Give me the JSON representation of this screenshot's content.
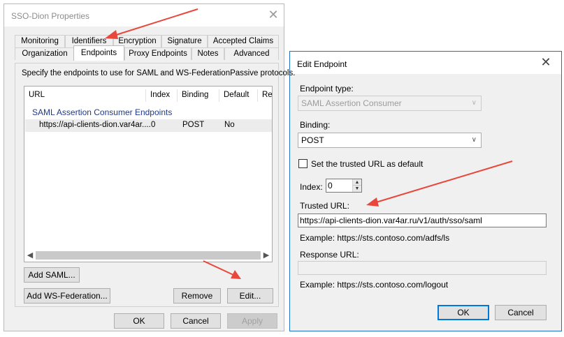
{
  "properties_dialog": {
    "title": "SSO-Dion Properties",
    "close_glyph": "✕",
    "tabs_row1": [
      "Monitoring",
      "Identifiers",
      "Encryption",
      "Signature",
      "Accepted Claims"
    ],
    "tabs_row2": [
      "Organization",
      "Endpoints",
      "Proxy Endpoints",
      "Notes",
      "Advanced"
    ],
    "active_tab": "Endpoints",
    "instruction": "Specify the endpoints to use for SAML and WS-FederationPassive protocols.",
    "list": {
      "columns": [
        "URL",
        "Index",
        "Binding",
        "Default",
        "Re"
      ],
      "group": "SAML Assertion Consumer Endpoints",
      "rows": [
        {
          "url": "https://api-clients-dion.var4ar....",
          "index": "0",
          "binding": "POST",
          "default": "No"
        }
      ]
    },
    "buttons": {
      "add_saml": "Add SAML...",
      "add_ws_federation": "Add WS-Federation...",
      "remove": "Remove",
      "edit": "Edit...",
      "ok": "OK",
      "cancel": "Cancel",
      "apply": "Apply"
    }
  },
  "edit_endpoint_dialog": {
    "title": "Edit Endpoint",
    "close_glyph": "✕",
    "endpoint_type_label": "Endpoint type:",
    "endpoint_type_value": "SAML Assertion Consumer",
    "binding_label": "Binding:",
    "binding_value": "POST",
    "set_default_label": "Set the trusted URL as default",
    "set_default_checked": false,
    "index_label": "Index:",
    "index_value": "0",
    "trusted_url_label": "Trusted URL:",
    "trusted_url_value": "https://api-clients-dion.var4ar.ru/v1/auth/sso/saml",
    "trusted_url_example": "Example: https://sts.contoso.com/adfs/ls",
    "response_url_label": "Response URL:",
    "response_url_value": "",
    "response_url_example": "Example: https://sts.contoso.com/logout",
    "ok": "OK",
    "cancel": "Cancel"
  },
  "annotation_color": "#e8473c"
}
